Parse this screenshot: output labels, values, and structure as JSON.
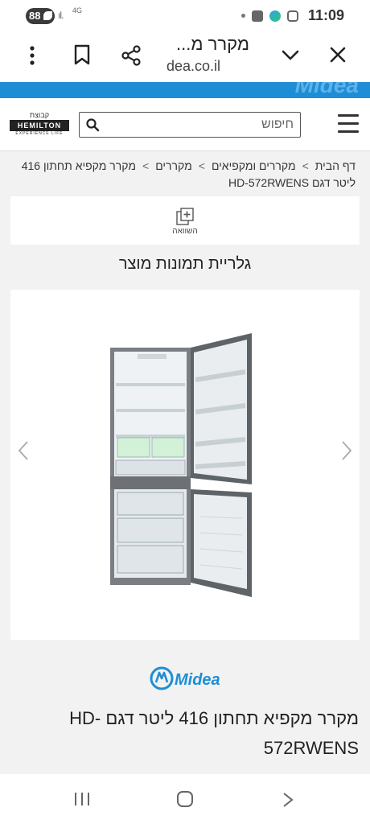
{
  "status_bar": {
    "battery": "88",
    "network": "4G",
    "time": "11:09"
  },
  "browser": {
    "page_title": "מקרר מ...",
    "url_host": "dea.co.il"
  },
  "site_header": {
    "search_placeholder": "חיפוש",
    "brand_group": "קבוצת",
    "brand_name": "HEMILTON",
    "brand_tagline": "EXPERIENCE LIFE"
  },
  "breadcrumb": {
    "items": [
      "דף הבית",
      "מקררים ומקפיאים",
      "מקררים",
      "מקרר מקפיא תחתון 416 ליטר דגם HD-572RWENS"
    ],
    "separator": ">"
  },
  "compare": {
    "label": "השוואה"
  },
  "gallery": {
    "title": "גלריית תמונות מוצר"
  },
  "product": {
    "brand": "Midea",
    "brand_color": "#1d8ed6",
    "title": "מקרר מקפיא תחתון 416 ליטר דגם HD-572RWENS"
  },
  "icons": [
    "battery-icon",
    "signal-icon",
    "notification-icon",
    "edge-icon",
    "instagram-icon",
    "more-vert-icon",
    "bookmark-icon",
    "share-icon",
    "chevron-down-icon",
    "close-icon",
    "hamburger-icon",
    "search-icon",
    "compare-icon",
    "chevron-left-icon",
    "chevron-right-icon",
    "recent-apps-icon",
    "home-icon",
    "back-icon"
  ]
}
